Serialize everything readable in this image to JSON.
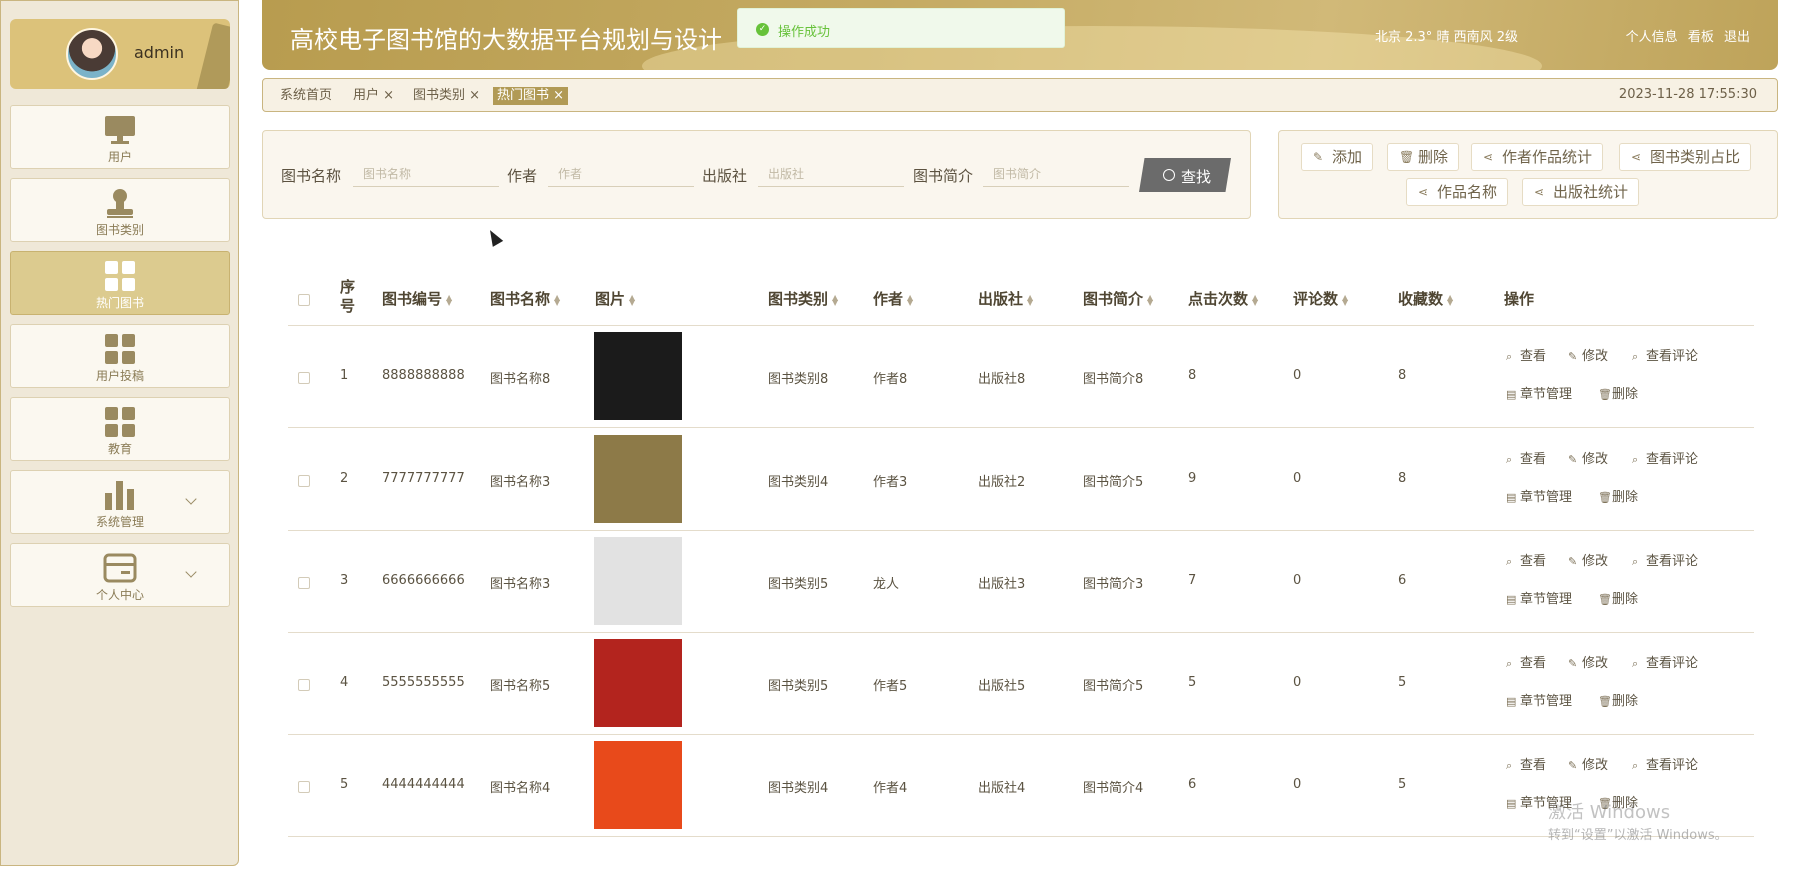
{
  "sidebar": {
    "username": "admin",
    "items": [
      {
        "label": "用户",
        "icon": "monitor-icon",
        "active": false,
        "has_children": false
      },
      {
        "label": "图书类别",
        "icon": "stamp-icon",
        "active": false,
        "has_children": false
      },
      {
        "label": "热门图书",
        "icon": "grid-icon",
        "active": true,
        "has_children": false
      },
      {
        "label": "用户投稿",
        "icon": "grid-icon",
        "active": false,
        "has_children": false
      },
      {
        "label": "教育",
        "icon": "grid-icon",
        "active": false,
        "has_children": false
      },
      {
        "label": "系统管理",
        "icon": "bar-chart-icon",
        "active": false,
        "has_children": true
      },
      {
        "label": "个人中心",
        "icon": "card-icon",
        "active": false,
        "has_children": true
      }
    ]
  },
  "header": {
    "title": "高校电子图书馆的大数据平台规划与设计",
    "weather": "北京  2.3°  晴  西南风  2级",
    "links": [
      "个人信息",
      "看板",
      "退出"
    ]
  },
  "toast": {
    "text": "操作成功"
  },
  "tabs": [
    {
      "label": "系统首页",
      "closable": false,
      "active": false
    },
    {
      "label": "用户",
      "closable": true,
      "active": false
    },
    {
      "label": "图书类别",
      "closable": true,
      "active": false
    },
    {
      "label": "热门图书",
      "closable": true,
      "active": true
    }
  ],
  "datetime": "2023-11-28 17:55:30",
  "search": {
    "fields": [
      {
        "label": "图书名称",
        "placeholder": "图书名称"
      },
      {
        "label": "作者",
        "placeholder": "作者"
      },
      {
        "label": "出版社",
        "placeholder": "出版社"
      },
      {
        "label": "图书简介",
        "placeholder": "图书简介"
      }
    ],
    "button": "查找"
  },
  "actions": [
    "添加",
    "删除",
    "作者作品统计",
    "图书类别占比",
    "作品名称",
    "出版社统计"
  ],
  "table": {
    "columns": [
      "序号",
      "图书编号",
      "图书名称",
      "图片",
      "图书类别",
      "作者",
      "出版社",
      "图书简介",
      "点击次数",
      "评论数",
      "收藏数",
      "操作"
    ],
    "row_ops": [
      "查看",
      "修改",
      "查看评论",
      "章节管理",
      "删除"
    ],
    "rows": [
      {
        "seq": "1",
        "code": "8888888888",
        "name": "图书名称8",
        "category": "图书类别8",
        "author": "作者8",
        "publisher": "出版社8",
        "intro": "图书简介8",
        "clicks": "8",
        "comments": "0",
        "favorites": "8",
        "cover_color": "#1b1b1b"
      },
      {
        "seq": "2",
        "code": "7777777777",
        "name": "图书名称3",
        "category": "图书类别4",
        "author": "作者3",
        "publisher": "出版社2",
        "intro": "图书简介5",
        "clicks": "9",
        "comments": "0",
        "favorites": "8",
        "cover_color": "#8d7a48"
      },
      {
        "seq": "3",
        "code": "6666666666",
        "name": "图书名称3",
        "category": "图书类别5",
        "author": "龙人",
        "publisher": "出版社3",
        "intro": "图书简介3",
        "clicks": "7",
        "comments": "0",
        "favorites": "6",
        "cover_color": "#e2e2e2"
      },
      {
        "seq": "4",
        "code": "5555555555",
        "name": "图书名称5",
        "category": "图书类别5",
        "author": "作者5",
        "publisher": "出版社5",
        "intro": "图书简介5",
        "clicks": "5",
        "comments": "0",
        "favorites": "5",
        "cover_color": "#b3241e"
      },
      {
        "seq": "5",
        "code": "4444444444",
        "name": "图书名称4",
        "category": "图书类别4",
        "author": "作者4",
        "publisher": "出版社4",
        "intro": "图书简介4",
        "clicks": "6",
        "comments": "0",
        "favorites": "5",
        "cover_color": "#e84a1b"
      }
    ]
  },
  "watermark": {
    "line1": "激活 Windows",
    "line2": "转到“设置”以激活 Windows。"
  }
}
